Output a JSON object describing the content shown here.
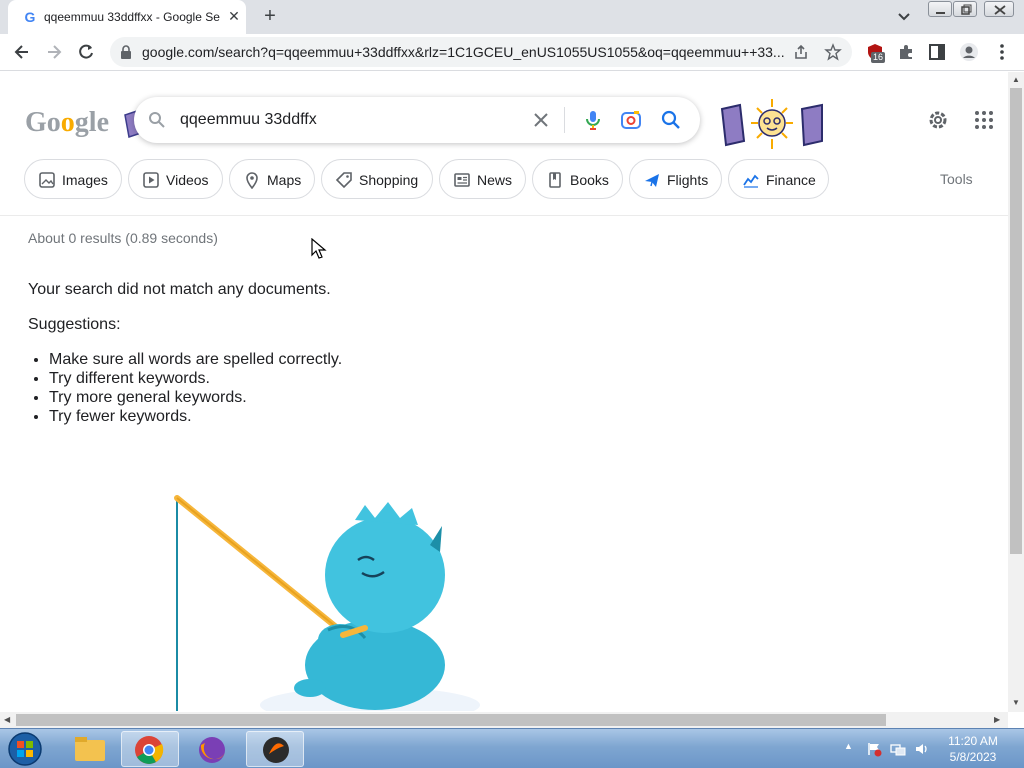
{
  "browser": {
    "tab_title": "qqeemmuu 33ddffxx - Google Se",
    "url": "google.com/search?q=qqeemmuu+33ddffxx&rlz=1C1GCEU_enUS1055US1055&oq=qqeemmuu++33...",
    "extension_badge": "16"
  },
  "search": {
    "logo_text": "Google",
    "query": "qqeemmuu 33ddffx"
  },
  "chips": [
    {
      "label": "Images",
      "icon": "image-icon"
    },
    {
      "label": "Videos",
      "icon": "video-icon"
    },
    {
      "label": "Maps",
      "icon": "map-pin-icon"
    },
    {
      "label": "Shopping",
      "icon": "tag-icon"
    },
    {
      "label": "News",
      "icon": "news-icon"
    },
    {
      "label": "Books",
      "icon": "book-icon"
    },
    {
      "label": "Flights",
      "icon": "plane-icon"
    },
    {
      "label": "Finance",
      "icon": "chart-icon"
    }
  ],
  "tools_label": "Tools",
  "results": {
    "stats": "About 0 results (0.89 seconds)",
    "no_match": "Your search did not match any documents.",
    "suggestions_label": "Suggestions:",
    "suggestions": [
      "Make sure all words are spelled correctly.",
      "Try different keywords.",
      "Try more general keywords.",
      "Try fewer keywords."
    ]
  },
  "taskbar": {
    "time": "11:20 AM",
    "date": "5/8/2023"
  },
  "colors": {
    "accent_blue": "#1a73e8",
    "google_blue": "#4285f4",
    "google_red": "#ea4335",
    "google_yellow": "#fbbc05",
    "google_green": "#34a853"
  }
}
